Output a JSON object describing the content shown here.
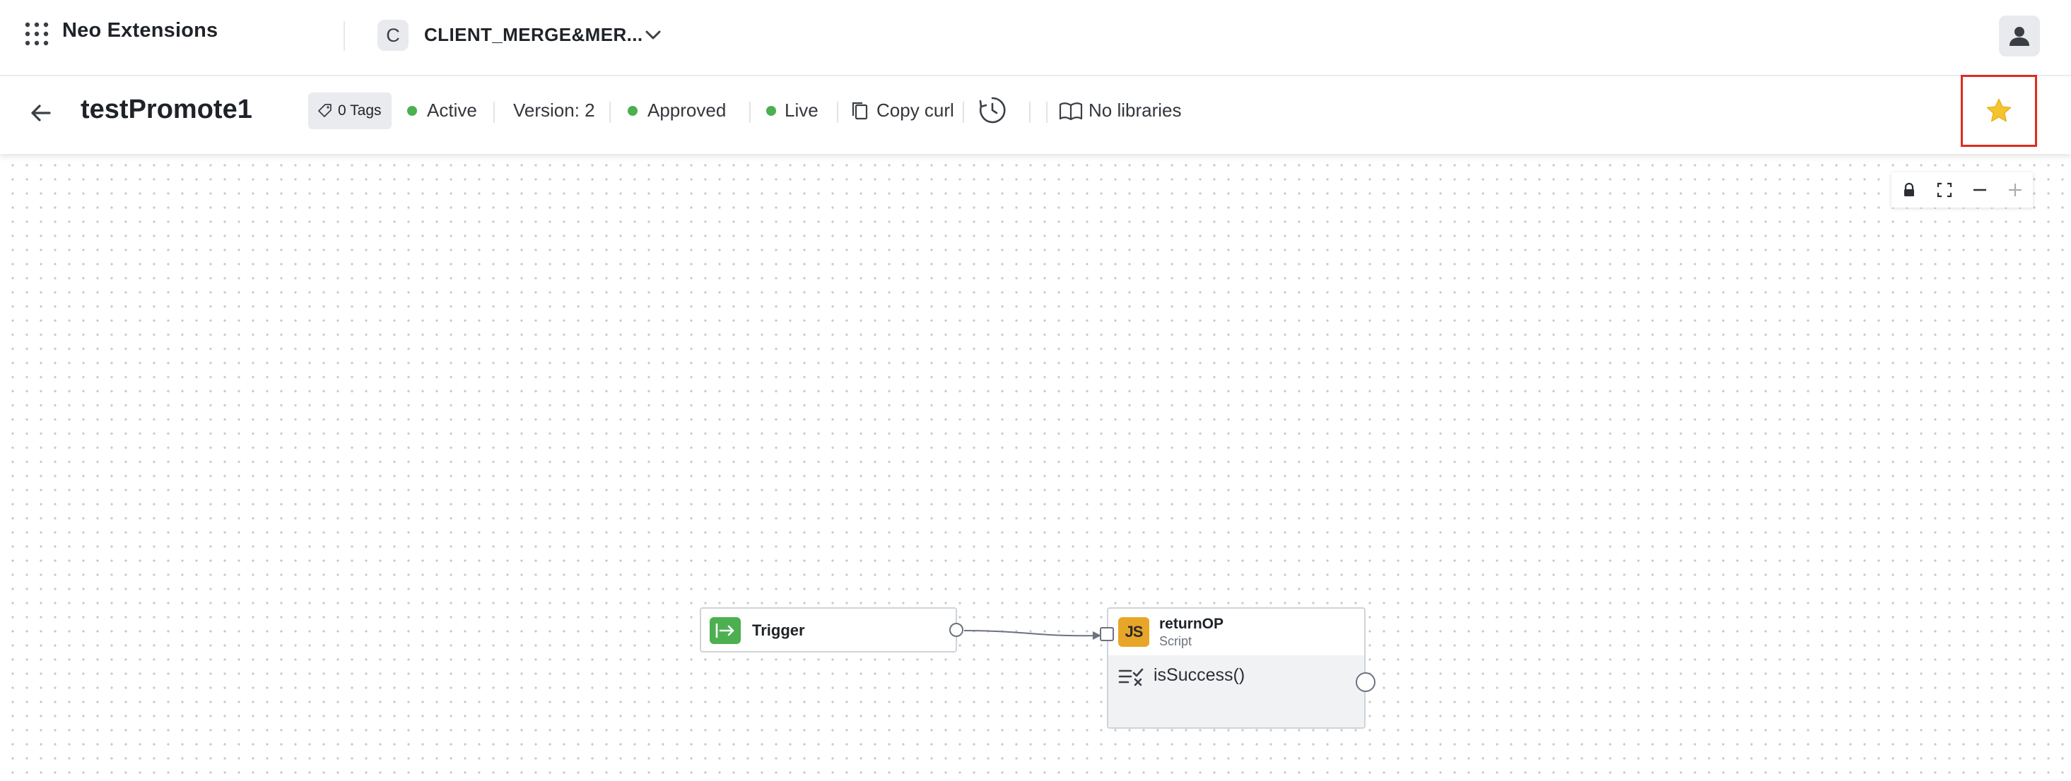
{
  "app": {
    "title": "Neo Extensions",
    "client_initial": "C",
    "client_name": "CLIENT_MERGE&MER..."
  },
  "workflow": {
    "title": "testPromote1",
    "tags_label": "0 Tags",
    "status": "Active",
    "version": "Version: 2",
    "approval": "Approved",
    "environment": "Live",
    "copy_curl": "Copy curl",
    "libraries": "No libraries"
  },
  "colors": {
    "status_green": "#4caf50",
    "star": "#f4c430",
    "highlight": "#e02b20",
    "trigger_icon": "#4caf50",
    "js_icon": "#e8a628"
  },
  "icons": {
    "apps": "apps-grid-icon",
    "client_dropdown": "chevron-down-icon",
    "avatar": "user-icon",
    "back": "arrow-left-icon",
    "tag": "tag-icon",
    "copy": "copy-icon",
    "history": "history-timer-icon",
    "libraries": "book-icon",
    "favorite": "star-icon",
    "lock": "lock-icon",
    "fit": "fullscreen-icon",
    "zoom_out": "minus-icon",
    "zoom_in": "plus-icon"
  },
  "canvas": {
    "nodes": [
      {
        "id": "trigger",
        "label": "Trigger"
      },
      {
        "id": "returnOP",
        "label": "returnOP",
        "subtitle": "Script",
        "condition": "isSuccess()"
      }
    ]
  }
}
